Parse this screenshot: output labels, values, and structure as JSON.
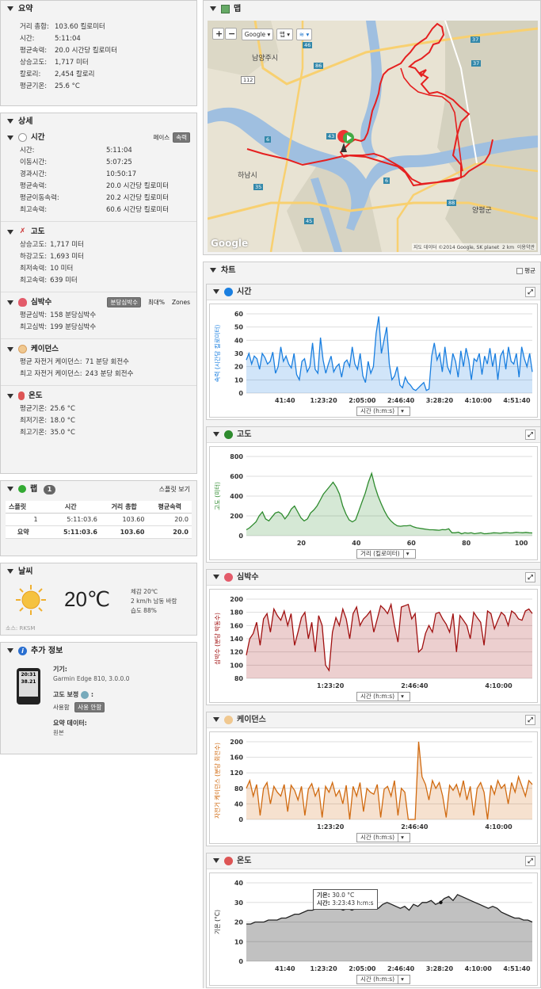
{
  "summary": {
    "title": "요약",
    "rows": [
      {
        "k": "거리 총합:",
        "v": "103.60 킬로미터"
      },
      {
        "k": "시간:",
        "v": "5:11:04"
      },
      {
        "k": "평균속력:",
        "v": "20.0 시간당 킬로미터"
      },
      {
        "k": "상승고도:",
        "v": "1,717 미터"
      },
      {
        "k": "칼로리:",
        "v": "2,454 칼로리"
      },
      {
        "k": "평균기온:",
        "v": "25.6 °C"
      }
    ]
  },
  "details": {
    "title": "상세",
    "time": {
      "title": "시간",
      "pace_label": "페이스",
      "speed_label": "속력",
      "rows": [
        {
          "k": "시간:",
          "v": "5:11:04"
        },
        {
          "k": "이동시간:",
          "v": "5:07:25"
        },
        {
          "k": "경과시간:",
          "v": "10:50:17"
        },
        {
          "k": "평균속력:",
          "v": "20.0 시간당 킬로미터"
        },
        {
          "k": "평균이동속력:",
          "v": "20.2 시간당 킬로미터"
        },
        {
          "k": "최고속력:",
          "v": "60.6 시간당 킬로미터"
        }
      ]
    },
    "elevation": {
      "title": "고도",
      "rows": [
        {
          "k": "상승고도:",
          "v": "1,717 미터"
        },
        {
          "k": "하강고도:",
          "v": "1,693 미터"
        },
        {
          "k": "최저속력:",
          "v": "10 미터"
        },
        {
          "k": "최고속력:",
          "v": "639 미터"
        }
      ]
    },
    "heart": {
      "title": "심박수",
      "btn1": "분당심박수",
      "btn2": "최대%",
      "btn3": "Zones",
      "rows": [
        {
          "k": "평균심박:",
          "v": "158 분당심박수"
        },
        {
          "k": "최고심박:",
          "v": "199 분당심박수"
        }
      ]
    },
    "cadence": {
      "title": "케이던스",
      "rows": [
        {
          "k": "평균 자전거 케이던스:",
          "v": "71 분당 회전수"
        },
        {
          "k": "최고 자전거 케이던스:",
          "v": "243 분당 회전수"
        }
      ]
    },
    "temp": {
      "title": "온도",
      "rows": [
        {
          "k": "평균기온:",
          "v": "25.6 °C"
        },
        {
          "k": "최저기온:",
          "v": "18.0 °C"
        },
        {
          "k": "최고기온:",
          "v": "35.0 °C"
        }
      ]
    }
  },
  "laps": {
    "title": "랩",
    "count": "1",
    "split_view": "스플릿 보기",
    "headers": [
      "스플릿",
      "시간",
      "거리 총합",
      "평균속력"
    ],
    "rows": [
      [
        "1",
        "5:11:03.6",
        "103.60",
        "20.0"
      ]
    ],
    "summary_row": [
      "요약",
      "5:11:03.6",
      "103.60",
      "20.0"
    ]
  },
  "weather": {
    "title": "날씨",
    "temp": "20℃",
    "feels": "체감 20℃",
    "wind": "2 km/h 남동 바람",
    "humidity": "습도 88%",
    "source": "소스: RKSM"
  },
  "extra": {
    "title": "추가 정보",
    "device_label": "기기:",
    "device_value": "Garmin Edge 810, 3.0.0.0",
    "elev_corr_label": "고도 보정",
    "use_btn": "사용함",
    "nouse_btn": "사용 안함",
    "summary_data_label": "요약 데이터:",
    "summary_data_value": "원본",
    "device_screen_1": "20:31",
    "device_screen_2": "38.21"
  },
  "map": {
    "title": "맵",
    "zoom_in": "+",
    "zoom_out": "−",
    "provider": "Google",
    "maptype": "맵",
    "labels": {
      "namyangju": "남양주시",
      "hanam": "하남시",
      "yangpyeong": "양평군",
      "r46": "46",
      "r37a": "37",
      "r37b": "37",
      "r86": "86",
      "r6a": "6",
      "r6b": "6",
      "r88": "88",
      "r45": "45",
      "r112": "112",
      "r35": "35",
      "r43": "43"
    },
    "attribution": "지도 데이터 ©2014 Google, SK planet",
    "scale": "2 km",
    "terms": "이용약관",
    "logo": "Google"
  },
  "charts": {
    "title": "차트",
    "avg_label": "평균",
    "axis_selector_time": "시간 (h:m:s)",
    "axis_selector_dist": "거리 (킬로미터)",
    "tooltip_temp_key": "기온:",
    "tooltip_temp_val": "30.0 °C",
    "tooltip_time_key": "시간:",
    "tooltip_time_val": "3:23:43 h:m:s"
  },
  "chart_data": [
    {
      "type": "area",
      "title": "시간",
      "ylabel": "속력 (시간당 킬로미터)",
      "xlabel": "시간 (h:m:s)",
      "ylim": [
        0,
        60
      ],
      "yticks": [
        0,
        10,
        20,
        30,
        40,
        50,
        60
      ],
      "xticks": [
        "41:40",
        "1:23:20",
        "2:05:00",
        "2:46:40",
        "3:28:20",
        "4:10:00",
        "4:51:40"
      ],
      "color": "#1a7fe0",
      "values": [
        25,
        30,
        22,
        28,
        26,
        18,
        30,
        27,
        22,
        24,
        31,
        15,
        20,
        35,
        24,
        28,
        22,
        19,
        30,
        14,
        10,
        24,
        26,
        16,
        20,
        38,
        18,
        15,
        42,
        25,
        15,
        22,
        28,
        16,
        20,
        22,
        12,
        23,
        25,
        20,
        35,
        22,
        18,
        30,
        13,
        8,
        24,
        15,
        20,
        45,
        58,
        30,
        40,
        50,
        22,
        10,
        13,
        20,
        6,
        4,
        12,
        8,
        6,
        3,
        2,
        4,
        6,
        8,
        2,
        3,
        28,
        38,
        25,
        30,
        16,
        35,
        20,
        15,
        30,
        24,
        12,
        32,
        20,
        34,
        25,
        10,
        26,
        24,
        30,
        14,
        28,
        22,
        34,
        20,
        30,
        10,
        28,
        32,
        18,
        35,
        24,
        22,
        30,
        12,
        35,
        26,
        20,
        30,
        16
      ]
    },
    {
      "type": "area",
      "title": "고도",
      "ylabel": "고도 (미터)",
      "xlabel": "거리 (킬로미터)",
      "ylim": [
        0,
        800
      ],
      "yticks": [
        0,
        200,
        400,
        600,
        800
      ],
      "xlim": [
        0,
        104
      ],
      "xticks": [
        20,
        40,
        60,
        80,
        100
      ],
      "color": "#2e8b2e",
      "values": [
        60,
        80,
        110,
        140,
        200,
        240,
        170,
        150,
        190,
        230,
        240,
        220,
        170,
        210,
        270,
        300,
        240,
        180,
        150,
        170,
        230,
        260,
        300,
        360,
        420,
        460,
        500,
        540,
        490,
        420,
        300,
        220,
        160,
        140,
        160,
        250,
        340,
        430,
        540,
        630,
        500,
        400,
        320,
        250,
        190,
        150,
        120,
        100,
        95,
        100,
        100,
        105,
        90,
        80,
        75,
        70,
        65,
        60,
        60,
        58,
        55,
        62,
        60,
        70,
        30,
        30,
        35,
        20,
        30,
        25,
        30,
        20,
        25,
        30,
        20,
        22,
        25,
        30,
        28,
        25,
        30,
        32,
        28,
        30,
        35,
        32,
        30,
        34,
        30,
        28
      ]
    },
    {
      "type": "area",
      "title": "심박수",
      "ylabel": "심박수 (분당 박동수)",
      "xlabel": "시간 (h:m:s)",
      "ylim": [
        80,
        200
      ],
      "yticks": [
        80,
        100,
        120,
        140,
        160,
        180,
        200
      ],
      "xticks": [
        "1:23:20",
        "2:46:40",
        "4:10:00"
      ],
      "color": "#a01010",
      "values": [
        115,
        140,
        148,
        165,
        130,
        170,
        178,
        150,
        185,
        175,
        168,
        182,
        160,
        178,
        130,
        150,
        172,
        180,
        140,
        165,
        120,
        175,
        160,
        100,
        92,
        150,
        172,
        160,
        185,
        170,
        140,
        178,
        188,
        160,
        170,
        175,
        182,
        150,
        170,
        190,
        185,
        178,
        192,
        160,
        135,
        188,
        190,
        192,
        170,
        178,
        120,
        125,
        148,
        160,
        150,
        178,
        180,
        170,
        162,
        150,
        178,
        120,
        175,
        168,
        160,
        140,
        180,
        172,
        165,
        130,
        182,
        178,
        155,
        168,
        180,
        175,
        160,
        182,
        178,
        170,
        168,
        182,
        185,
        178
      ]
    },
    {
      "type": "area",
      "title": "케이던스",
      "ylabel": "자전거 케이던스 (분당 회전수)",
      "xlabel": "시간 (h:m:s)",
      "ylim": [
        0,
        200
      ],
      "yticks": [
        0,
        40,
        80,
        120,
        160,
        200
      ],
      "xticks": [
        "1:23:20",
        "2:46:40",
        "4:10:00"
      ],
      "color": "#d06a10",
      "values": [
        80,
        100,
        60,
        90,
        10,
        80,
        95,
        40,
        85,
        70,
        60,
        90,
        20,
        88,
        75,
        50,
        85,
        10,
        78,
        92,
        60,
        80,
        5,
        85,
        70,
        95,
        60,
        75,
        40,
        88,
        0,
        85,
        60,
        95,
        20,
        80,
        70,
        65,
        90,
        5,
        78,
        85,
        60,
        100,
        10,
        80,
        70,
        0,
        0,
        0,
        210,
        110,
        90,
        50,
        100,
        80,
        95,
        60,
        5,
        88,
        75,
        90,
        60,
        100,
        50,
        85,
        10,
        80,
        95,
        70,
        0,
        88,
        65,
        100,
        80,
        90,
        40,
        95,
        70,
        110,
        85,
        60,
        100,
        90
      ]
    },
    {
      "type": "area",
      "title": "온도",
      "ylabel": "기온 (°C)",
      "xlabel": "시간 (h:m:s)",
      "ylim": [
        0,
        40
      ],
      "yticks": [
        0,
        10,
        20,
        30,
        40
      ],
      "xticks": [
        "41:40",
        "1:23:20",
        "2:05:00",
        "2:46:40",
        "3:28:20",
        "4:10:00",
        "4:51:40"
      ],
      "color": "#222222",
      "values": [
        19,
        19,
        20,
        20,
        20,
        21,
        21,
        21,
        22,
        22,
        23,
        24,
        24,
        25,
        26,
        26,
        27,
        27,
        28,
        27,
        28,
        27,
        26,
        27,
        26,
        27,
        28,
        27,
        29,
        28,
        27,
        29,
        30,
        29,
        28,
        27,
        28,
        26,
        29,
        28,
        30,
        30,
        31,
        29,
        30,
        32,
        33,
        31,
        34,
        33,
        32,
        31,
        30,
        29,
        28,
        27,
        28,
        27,
        25,
        24,
        23,
        22,
        22,
        21,
        21,
        20
      ]
    }
  ]
}
